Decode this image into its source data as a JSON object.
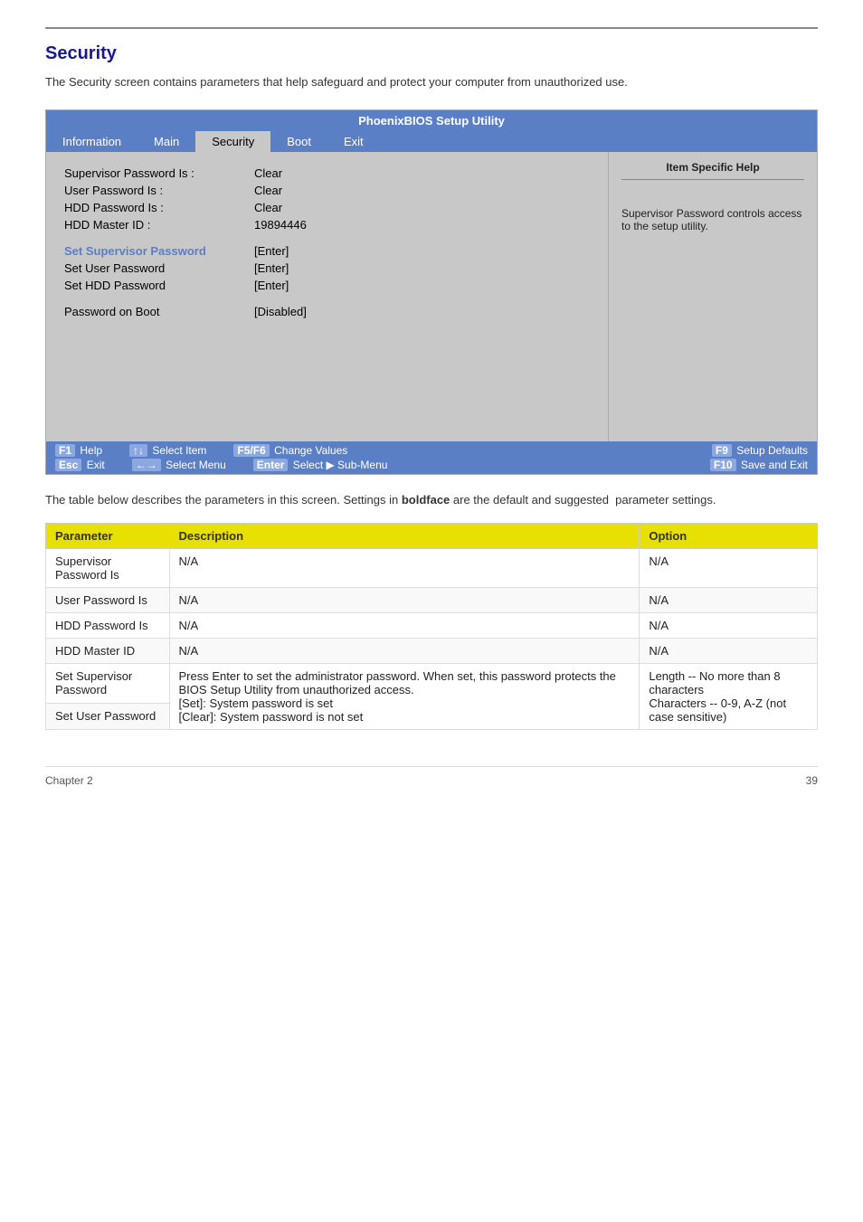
{
  "page": {
    "title": "Security",
    "intro": "The Security screen contains parameters that help safeguard and protect your computer from unauthorized use.",
    "desc_text": "The table below describes the parameters in this screen. Settings in boldface are the default and suggested  parameter settings.",
    "chapter": "Chapter 2",
    "page_number": "39"
  },
  "bios": {
    "title": "PhoenixBIOS Setup Utility",
    "nav_items": [
      {
        "label": "Information",
        "active": false
      },
      {
        "label": "Main",
        "active": false
      },
      {
        "label": "Security",
        "active": true
      },
      {
        "label": "Boot",
        "active": false
      },
      {
        "label": "Exit",
        "active": false
      }
    ],
    "right_panel": {
      "title": "Item Specific Help",
      "content": "Supervisor Password controls access to the setup utility."
    },
    "fields": [
      {
        "label": "Supervisor Password Is :",
        "value": "Clear",
        "highlighted": false
      },
      {
        "label": "User Password Is :",
        "value": "Clear",
        "highlighted": false
      },
      {
        "label": "HDD Password Is :",
        "value": "Clear",
        "highlighted": false
      },
      {
        "label": "HDD Master ID :",
        "value": "19894446",
        "highlighted": false
      },
      {
        "label": "",
        "value": "",
        "spacer": true
      },
      {
        "label": "Set Supervisor Password",
        "value": "[Enter]",
        "highlighted": true
      },
      {
        "label": "Set User Password",
        "value": "[Enter]",
        "highlighted": false
      },
      {
        "label": "Set HDD Password",
        "value": "[Enter]",
        "highlighted": false
      },
      {
        "label": "",
        "value": "",
        "spacer": true
      },
      {
        "label": "Password on Boot",
        "value": "[Disabled]",
        "highlighted": false
      }
    ],
    "footer_rows": [
      [
        {
          "key": "F1",
          "action": "Help"
        },
        {
          "key": "↑↓",
          "action": "Select Item"
        },
        {
          "key": "F5/F6",
          "action": "Change Values"
        },
        {
          "key": "F9",
          "action": "Setup Defaults"
        }
      ],
      [
        {
          "key": "Esc",
          "action": "Exit"
        },
        {
          "key": "←→",
          "action": "Select Menu"
        },
        {
          "key": "Enter",
          "action": "Select  ▶ Sub-Menu"
        },
        {
          "key": "F10",
          "action": "Save and Exit"
        }
      ]
    ]
  },
  "table": {
    "headers": [
      "Parameter",
      "Description",
      "Option"
    ],
    "rows": [
      {
        "param": "Supervisor Password Is",
        "desc": "N/A",
        "option": "N/A"
      },
      {
        "param": "User Password Is",
        "desc": "N/A",
        "option": "N/A"
      },
      {
        "param": "HDD Password Is",
        "desc": "N/A",
        "option": "N/A"
      },
      {
        "param": "HDD Master ID",
        "desc": "N/A",
        "option": "N/A"
      },
      {
        "param": "Set Supervisor Password",
        "desc_combined": "Press Enter to set the administrator password. When set, this password protects the BIOS Setup Utility from unauthorized access.\n[Set]: System password is set\n[Clear]: System password is not set",
        "option_combined": "Length -- No more than 8 characters\nCharacters -- 0-9, A-Z (not case sensitive)",
        "rowspan": 2
      },
      {
        "param": "Set User Password",
        "desc_combined": null,
        "option_combined": null,
        "skip": true
      }
    ]
  }
}
